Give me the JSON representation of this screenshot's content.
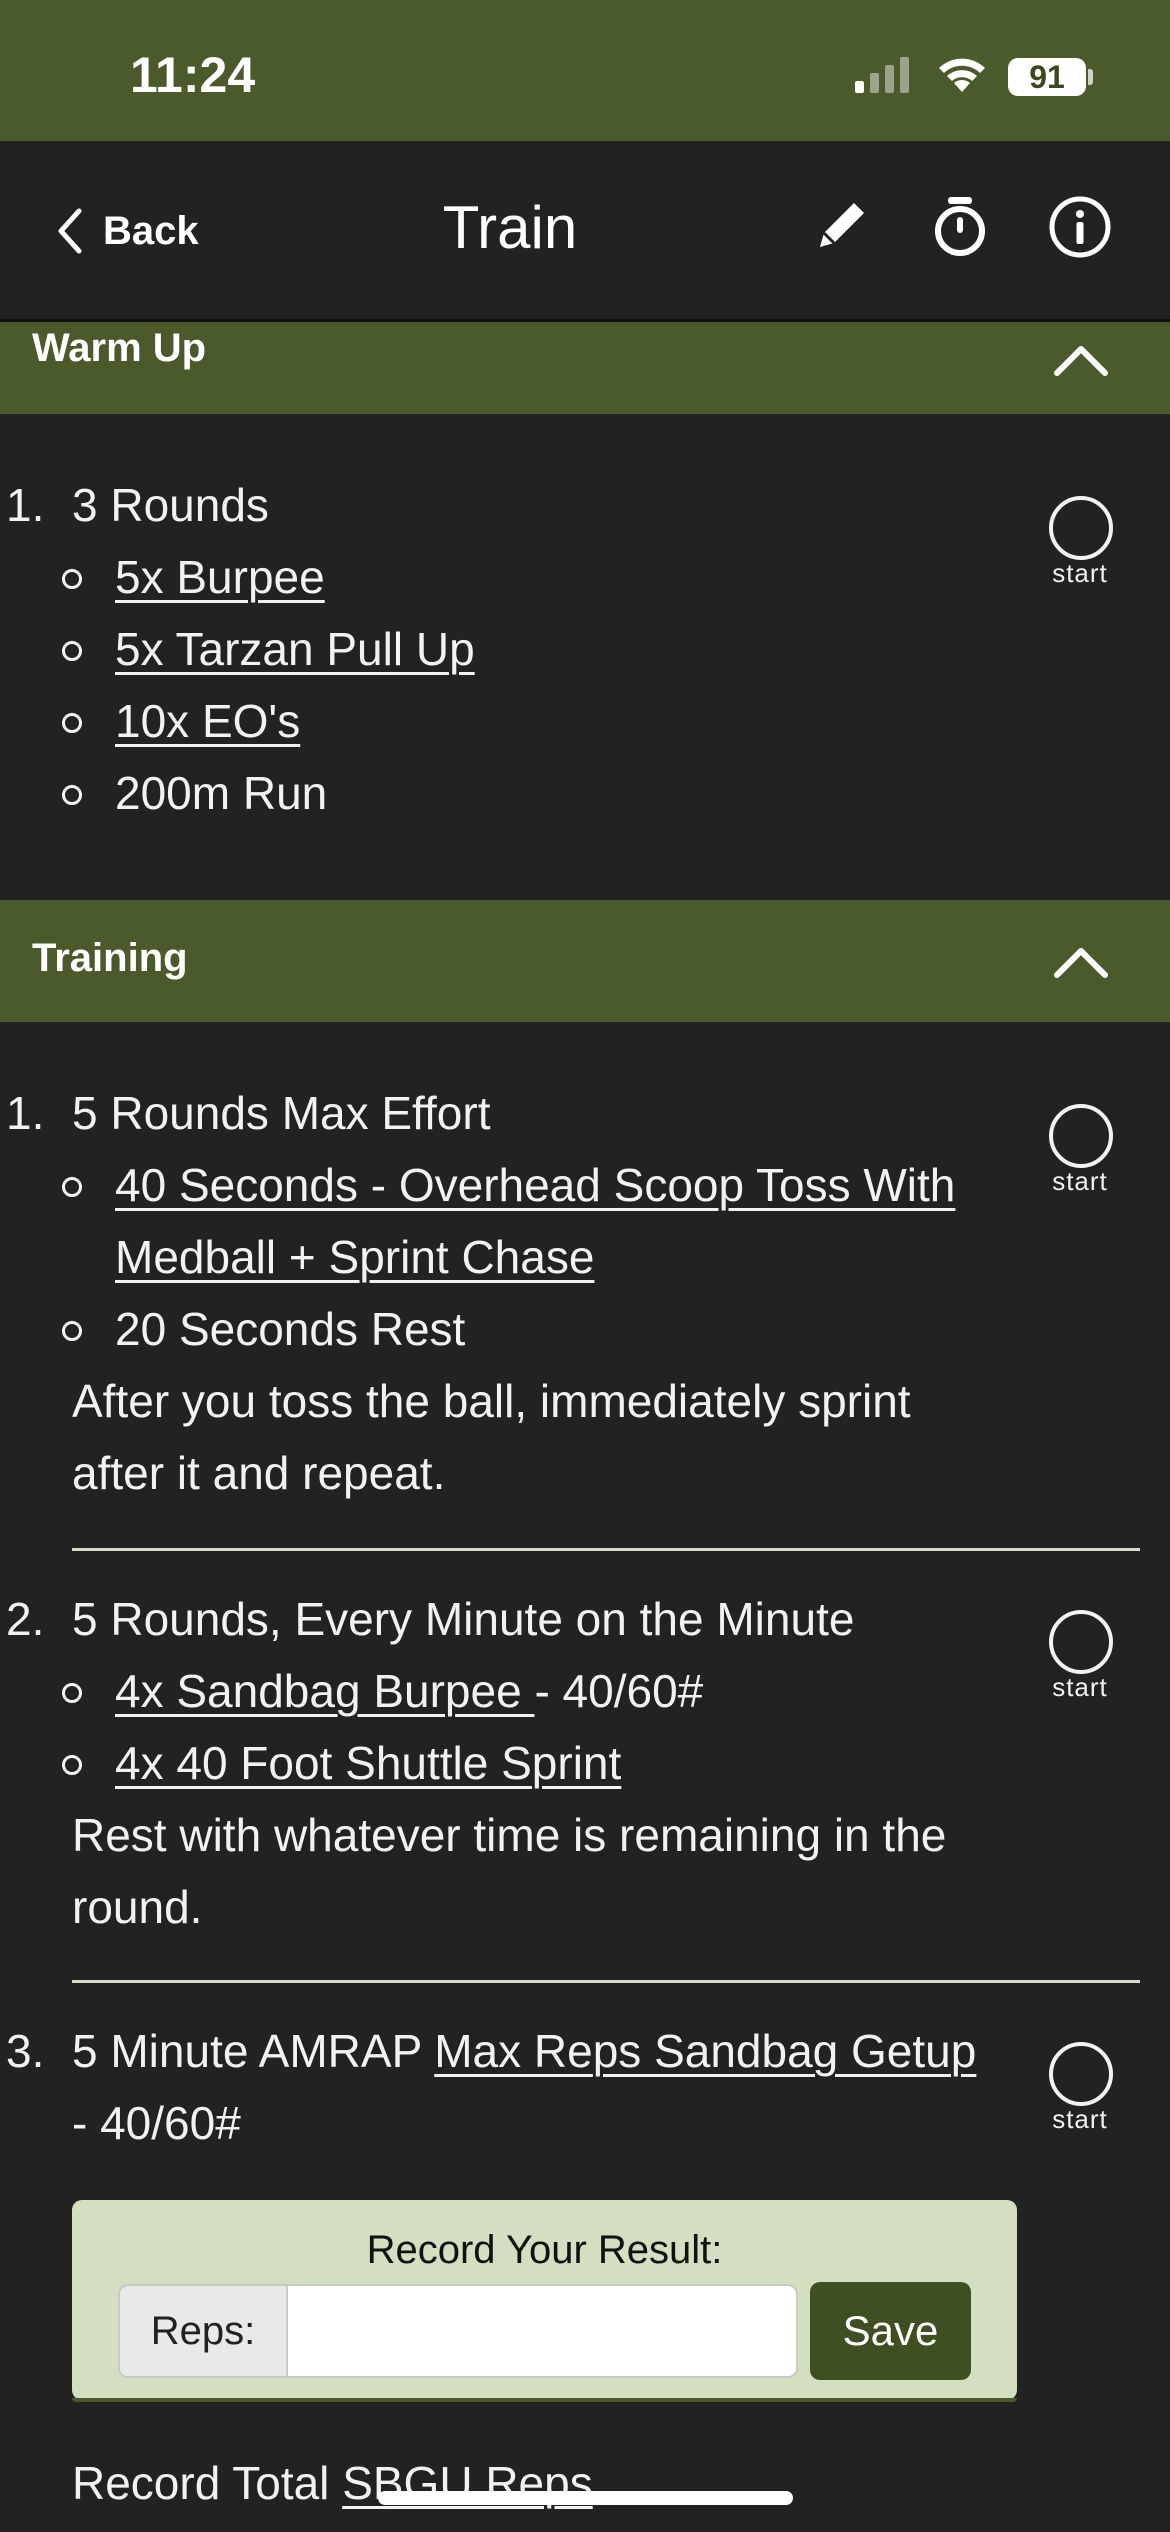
{
  "status_bar": {
    "time": "11:24",
    "battery": "91"
  },
  "nav": {
    "back_label": "Back",
    "title": "Train"
  },
  "warmup": {
    "title": "Warm Up",
    "item1": {
      "number": "1.",
      "title": "3 Rounds",
      "bullets": [
        "5x Burpee",
        "5x Tarzan Pull Up",
        "10x EO's",
        "200m Run"
      ],
      "start_label": "start"
    }
  },
  "training": {
    "title": "Training",
    "item1": {
      "number": "1.",
      "title": "5 Rounds Max Effort",
      "bullet1_line1": "40 Seconds - Overhead Scoop Toss With",
      "bullet1_line2": "Medball + Sprint Chase",
      "bullet2": "20 Seconds Rest",
      "note_line1": "After you toss the ball, immediately sprint",
      "note_line2": "after it and repeat.",
      "start_label": "start"
    },
    "item2": {
      "number": "2.",
      "title": "5 Rounds, Every Minute on the Minute",
      "bullet1_link": "4x Sandbag Burpee ",
      "bullet1_suffix": "- 40/60#",
      "bullet2": "4x 40 Foot Shuttle Sprint",
      "note_line1": "Rest with whatever time is remaining in the",
      "note_line2": "round.",
      "start_label": "start"
    },
    "item3": {
      "number": "3.",
      "title_prefix": "5 Minute AMRAP ",
      "title_link": "Max Reps Sandbag Getup",
      "title_line2": "- 40/60#",
      "start_label": "start"
    }
  },
  "record": {
    "title": "Record Your Result:",
    "reps_label": "Reps:",
    "reps_value": "",
    "save_label": "Save"
  },
  "footer_text_prefix": "Record Total ",
  "footer_text_link": "SBGU Reps"
}
